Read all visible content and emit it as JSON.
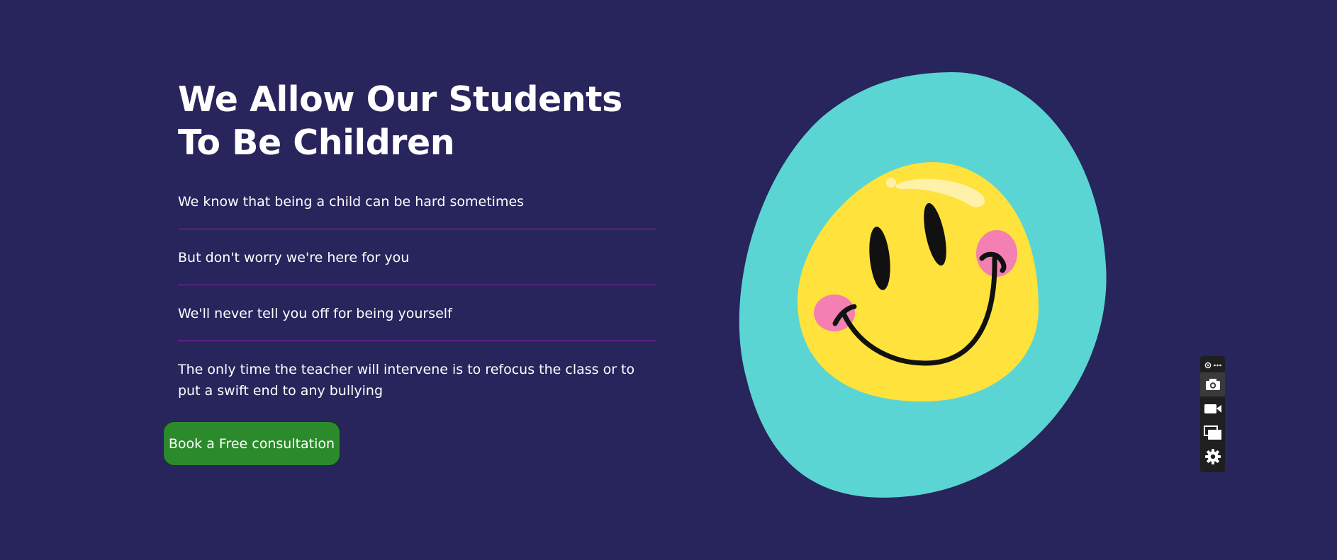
{
  "hero": {
    "headline": "We Allow Our Students To Be Children",
    "points": [
      "We know that being a child can be hard sometimes",
      "But don't worry we're here for you",
      "We'll never tell you off for being yourself",
      "The only time the teacher will intervene is to refocus the class or to put a swift end to any bullying"
    ],
    "cta_label": "Book a Free consultation"
  },
  "colors": {
    "background": "#28245c",
    "divider": "#9a1fb0",
    "cta": "#2b8a2b",
    "blob": "#5ad5d4",
    "face": "#ffe23c",
    "cheek": "#f47fb2"
  },
  "illustration": {
    "icon": "smiley-face-icon"
  },
  "toolbar": {
    "icons": [
      "capture-extension-icon",
      "more-icon",
      "camera-icon",
      "video-icon",
      "window-icon",
      "settings-icon"
    ]
  }
}
